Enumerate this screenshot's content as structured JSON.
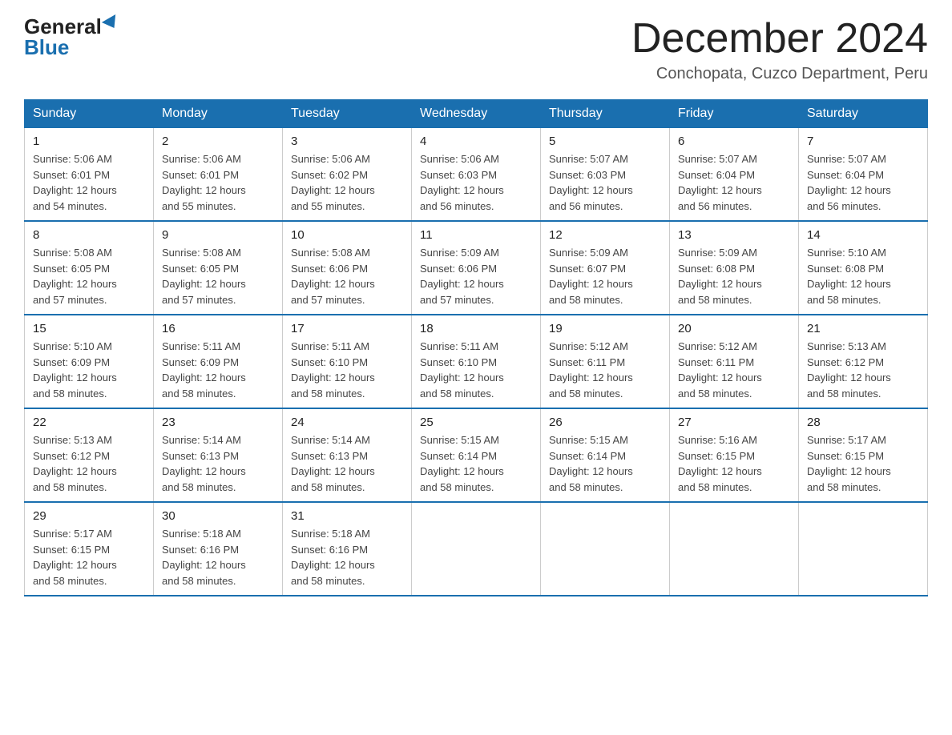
{
  "logo": {
    "general": "General",
    "blue": "Blue"
  },
  "title": "December 2024",
  "location": "Conchopata, Cuzco Department, Peru",
  "days_of_week": [
    "Sunday",
    "Monday",
    "Tuesday",
    "Wednesday",
    "Thursday",
    "Friday",
    "Saturday"
  ],
  "weeks": [
    [
      {
        "day": "1",
        "sunrise": "5:06 AM",
        "sunset": "6:01 PM",
        "daylight": "12 hours and 54 minutes."
      },
      {
        "day": "2",
        "sunrise": "5:06 AM",
        "sunset": "6:01 PM",
        "daylight": "12 hours and 55 minutes."
      },
      {
        "day": "3",
        "sunrise": "5:06 AM",
        "sunset": "6:02 PM",
        "daylight": "12 hours and 55 minutes."
      },
      {
        "day": "4",
        "sunrise": "5:06 AM",
        "sunset": "6:03 PM",
        "daylight": "12 hours and 56 minutes."
      },
      {
        "day": "5",
        "sunrise": "5:07 AM",
        "sunset": "6:03 PM",
        "daylight": "12 hours and 56 minutes."
      },
      {
        "day": "6",
        "sunrise": "5:07 AM",
        "sunset": "6:04 PM",
        "daylight": "12 hours and 56 minutes."
      },
      {
        "day": "7",
        "sunrise": "5:07 AM",
        "sunset": "6:04 PM",
        "daylight": "12 hours and 56 minutes."
      }
    ],
    [
      {
        "day": "8",
        "sunrise": "5:08 AM",
        "sunset": "6:05 PM",
        "daylight": "12 hours and 57 minutes."
      },
      {
        "day": "9",
        "sunrise": "5:08 AM",
        "sunset": "6:05 PM",
        "daylight": "12 hours and 57 minutes."
      },
      {
        "day": "10",
        "sunrise": "5:08 AM",
        "sunset": "6:06 PM",
        "daylight": "12 hours and 57 minutes."
      },
      {
        "day": "11",
        "sunrise": "5:09 AM",
        "sunset": "6:06 PM",
        "daylight": "12 hours and 57 minutes."
      },
      {
        "day": "12",
        "sunrise": "5:09 AM",
        "sunset": "6:07 PM",
        "daylight": "12 hours and 58 minutes."
      },
      {
        "day": "13",
        "sunrise": "5:09 AM",
        "sunset": "6:08 PM",
        "daylight": "12 hours and 58 minutes."
      },
      {
        "day": "14",
        "sunrise": "5:10 AM",
        "sunset": "6:08 PM",
        "daylight": "12 hours and 58 minutes."
      }
    ],
    [
      {
        "day": "15",
        "sunrise": "5:10 AM",
        "sunset": "6:09 PM",
        "daylight": "12 hours and 58 minutes."
      },
      {
        "day": "16",
        "sunrise": "5:11 AM",
        "sunset": "6:09 PM",
        "daylight": "12 hours and 58 minutes."
      },
      {
        "day": "17",
        "sunrise": "5:11 AM",
        "sunset": "6:10 PM",
        "daylight": "12 hours and 58 minutes."
      },
      {
        "day": "18",
        "sunrise": "5:11 AM",
        "sunset": "6:10 PM",
        "daylight": "12 hours and 58 minutes."
      },
      {
        "day": "19",
        "sunrise": "5:12 AM",
        "sunset": "6:11 PM",
        "daylight": "12 hours and 58 minutes."
      },
      {
        "day": "20",
        "sunrise": "5:12 AM",
        "sunset": "6:11 PM",
        "daylight": "12 hours and 58 minutes."
      },
      {
        "day": "21",
        "sunrise": "5:13 AM",
        "sunset": "6:12 PM",
        "daylight": "12 hours and 58 minutes."
      }
    ],
    [
      {
        "day": "22",
        "sunrise": "5:13 AM",
        "sunset": "6:12 PM",
        "daylight": "12 hours and 58 minutes."
      },
      {
        "day": "23",
        "sunrise": "5:14 AM",
        "sunset": "6:13 PM",
        "daylight": "12 hours and 58 minutes."
      },
      {
        "day": "24",
        "sunrise": "5:14 AM",
        "sunset": "6:13 PM",
        "daylight": "12 hours and 58 minutes."
      },
      {
        "day": "25",
        "sunrise": "5:15 AM",
        "sunset": "6:14 PM",
        "daylight": "12 hours and 58 minutes."
      },
      {
        "day": "26",
        "sunrise": "5:15 AM",
        "sunset": "6:14 PM",
        "daylight": "12 hours and 58 minutes."
      },
      {
        "day": "27",
        "sunrise": "5:16 AM",
        "sunset": "6:15 PM",
        "daylight": "12 hours and 58 minutes."
      },
      {
        "day": "28",
        "sunrise": "5:17 AM",
        "sunset": "6:15 PM",
        "daylight": "12 hours and 58 minutes."
      }
    ],
    [
      {
        "day": "29",
        "sunrise": "5:17 AM",
        "sunset": "6:15 PM",
        "daylight": "12 hours and 58 minutes."
      },
      {
        "day": "30",
        "sunrise": "5:18 AM",
        "sunset": "6:16 PM",
        "daylight": "12 hours and 58 minutes."
      },
      {
        "day": "31",
        "sunrise": "5:18 AM",
        "sunset": "6:16 PM",
        "daylight": "12 hours and 58 minutes."
      },
      null,
      null,
      null,
      null
    ]
  ],
  "labels": {
    "sunrise": "Sunrise:",
    "sunset": "Sunset:",
    "daylight": "Daylight:"
  }
}
